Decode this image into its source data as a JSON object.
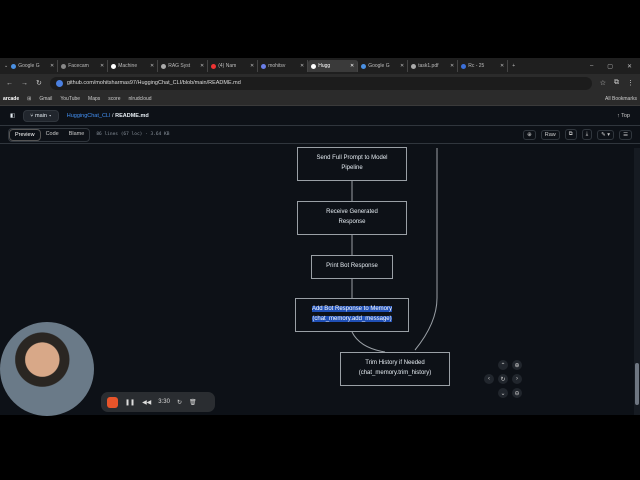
{
  "browser": {
    "tabs": [
      {
        "label": "Google G",
        "color": "#4a90e2"
      },
      {
        "label": "Facecam",
        "color": "#888"
      },
      {
        "label": "Machine",
        "color": "#fff"
      },
      {
        "label": "RAG Syst",
        "color": "#aaa"
      },
      {
        "label": "(4) Nam",
        "color": "#e33"
      },
      {
        "label": "mohitsv",
        "color": "#6a7ee8"
      },
      {
        "label": "Hugg",
        "color": "#fff",
        "active": true
      },
      {
        "label": "Google G",
        "color": "#4a90e2"
      },
      {
        "label": "task1.pdf",
        "color": "#aaa"
      },
      {
        "label": "Rc - 25",
        "color": "#3b6fd8"
      }
    ],
    "url": "github.com/mohitsharmas97/HuggingChat_CLI/blob/main/README.md",
    "bookmarks": [
      "arcade",
      "Gmail",
      "YouTube",
      "Maps",
      "score",
      "nlrudcloud"
    ],
    "all_bookmarks": "All Bookmarks"
  },
  "github": {
    "branch": "main",
    "repo": "HuggingChat_CLI",
    "file": "README.md",
    "top": "Top",
    "views": [
      "Preview",
      "Code",
      "Blame"
    ],
    "meta": "86 lines (67 loc) · 3.64 KB",
    "raw": "Raw"
  },
  "diagram": {
    "nodes": [
      {
        "l1": "Send Full Prompt to Model",
        "l2": "Pipeline"
      },
      {
        "l1": "Receive Generated",
        "l2": "Response"
      },
      {
        "l1": "Print Bot Response",
        "l2": ""
      },
      {
        "l1": "Add Bot Response to Memory",
        "l2": "(chat_memory.add_message)"
      },
      {
        "l1": "Trim History if Needed",
        "l2": "(chat_memory.trim_history)"
      }
    ]
  },
  "recorder": {
    "time": "3:30",
    "stop_color": "#e8542a"
  }
}
